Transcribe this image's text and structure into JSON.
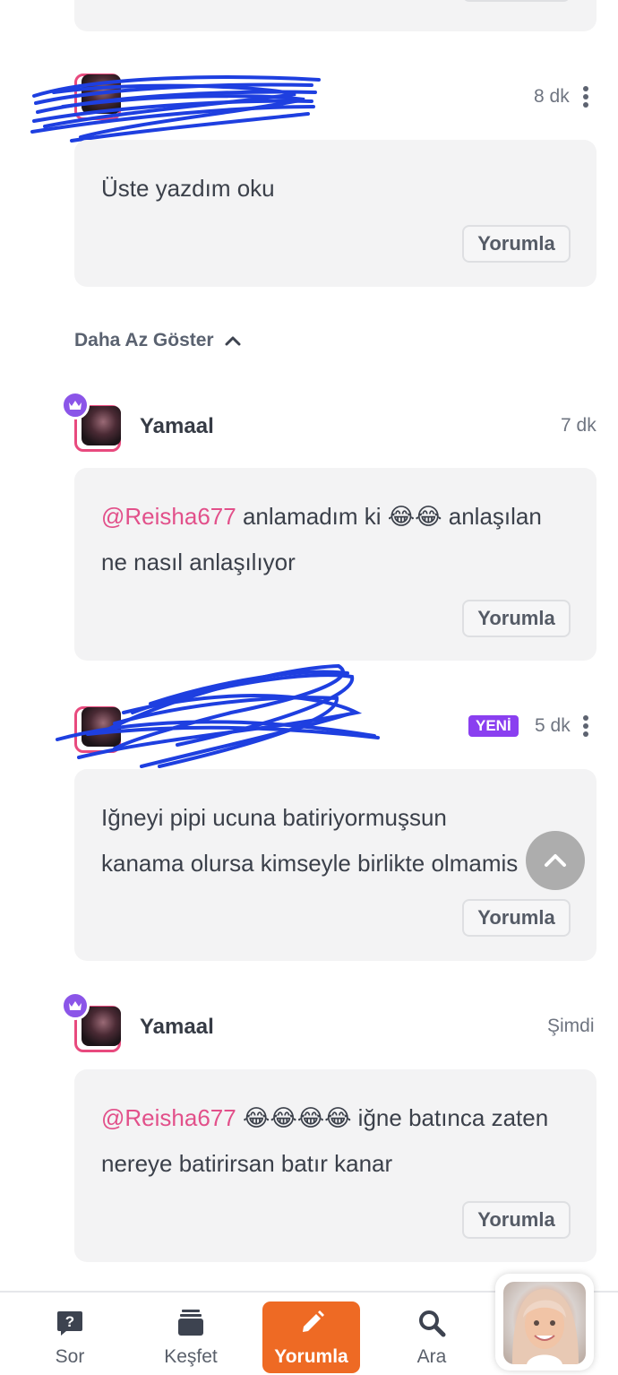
{
  "comments": [
    {
      "time": "8 dk",
      "text": "Üste yazdım oku",
      "reply_label": "Yorumla"
    },
    {
      "username": "Yamaal",
      "time": "7 dk",
      "mention": "@Reisha677",
      "text_a": " anlamadım ki 😂😂 anlaşılan",
      "text_b": "ne nasıl anlaşılıyor",
      "reply_label": "Yorumla"
    },
    {
      "badge": "YENİ",
      "time": "5 dk",
      "text_a": "Iğneyi pipi ucuna batiriyormuşsun",
      "text_b": "kanama olursa kimseyle birlikte olmamis",
      "reply_label": "Yorumla"
    },
    {
      "username": "Yamaal",
      "time": "Şimdi",
      "mention": "@Reisha677",
      "text_a": " 😂😂😂😂 iğne batınca zaten",
      "text_b": "nereye batirirsan batır kanar",
      "reply_label": "Yorumla"
    }
  ],
  "top_card": {
    "reply_label": ""
  },
  "show_less_label": "Daha Az Göster",
  "nav": {
    "items": [
      {
        "label": "Sor",
        "icon": "question-icon"
      },
      {
        "label": "Keşfet",
        "icon": "stack-icon"
      },
      {
        "label": "Yorumla",
        "icon": "pencil-icon"
      },
      {
        "label": "Ara",
        "icon": "search-icon"
      }
    ]
  },
  "colors": {
    "accent_orange": "#ee6a24",
    "mention_pink": "#e2508a",
    "badge_purple": "#8a3ff0",
    "scribble_blue": "#1e3fe0"
  }
}
